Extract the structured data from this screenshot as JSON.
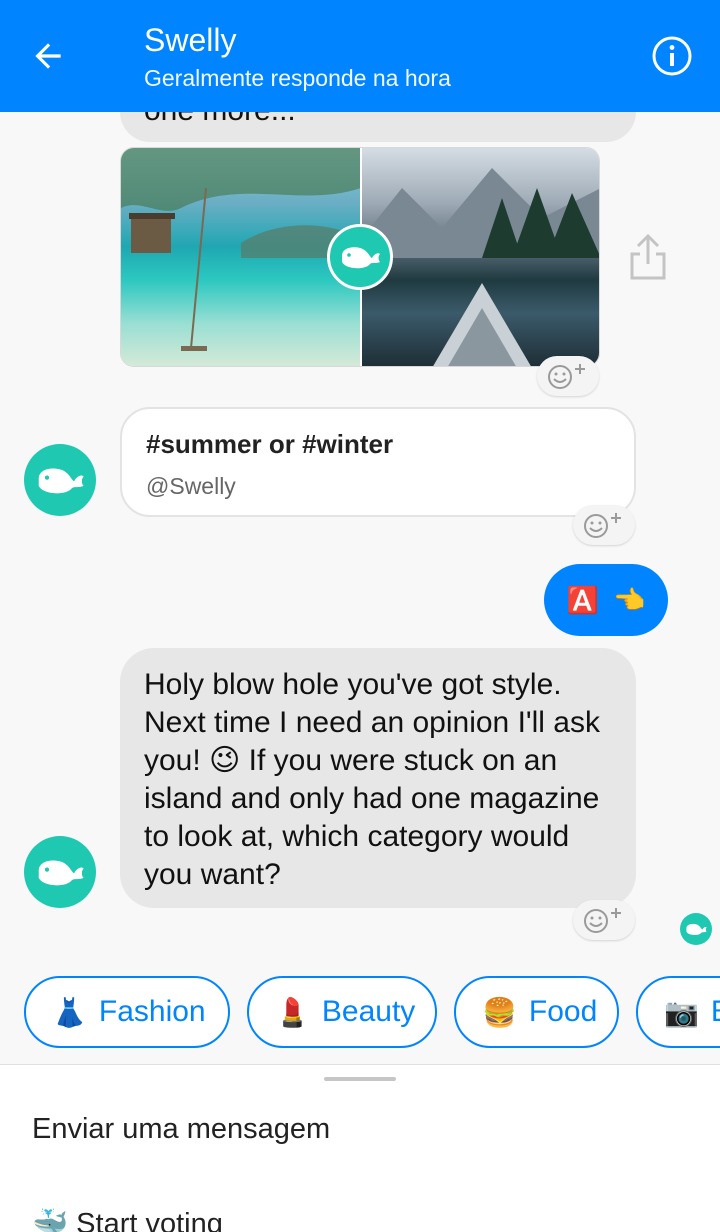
{
  "header": {
    "title": "Swelly",
    "subtitle": "Geralmente responde na hora"
  },
  "messages": {
    "clipped_text": "one more...",
    "caption_title": "#summer or #winter",
    "caption_handle": "@Swelly",
    "sent_emoji_1": "🅰️",
    "sent_emoji_2": "👈",
    "bot_text": "Holy blow hole you've got style. Next time I need an opinion I'll ask you! 😉 If you were stuck on an island and only had one magazine to look at, which category would you want?"
  },
  "quick_replies": [
    {
      "emoji": "👗",
      "label": "Fashion"
    },
    {
      "emoji": "💄",
      "label": "Beauty"
    },
    {
      "emoji": "🍔",
      "label": "Food"
    },
    {
      "emoji": "📷",
      "label": "Be"
    }
  ],
  "menu": {
    "item_1": "Enviar uma mensagem",
    "item_2_emoji": "🐳",
    "item_2": "Start voting"
  },
  "colors": {
    "header": "#0084ff",
    "brand_teal": "#1fc8b0",
    "bot_bubble": "#e7e7e7"
  },
  "icons": {
    "back": "arrow-left-icon",
    "info": "info-icon",
    "share": "share-icon",
    "react": "emoji-add-icon",
    "logo": "whale-icon"
  }
}
